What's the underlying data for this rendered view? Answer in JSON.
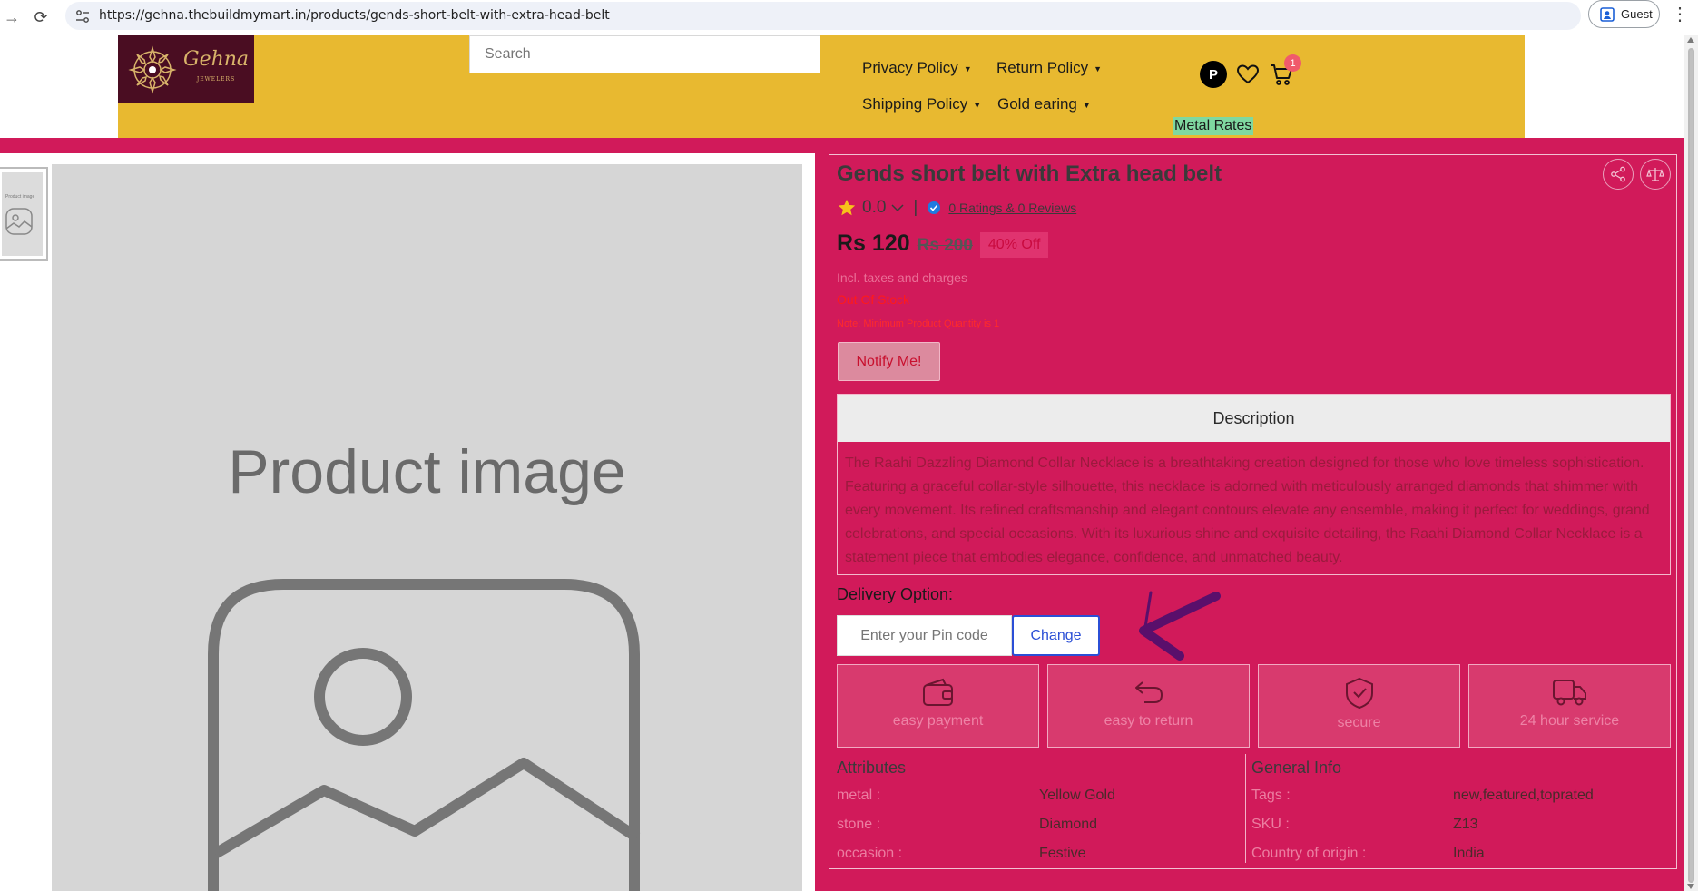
{
  "browser": {
    "url": "https://gehna.thebuildmymart.in/products/gends-short-belt-with-extra-head-belt",
    "profile_label": "Guest"
  },
  "header": {
    "logo": {
      "brand": "Gehna",
      "tagline": "JEWELERS"
    },
    "search_placeholder": "Search",
    "menu": [
      {
        "label": "Privacy Policy"
      },
      {
        "label": "Return Policy"
      },
      {
        "label": "Shipping Policy"
      },
      {
        "label": "Gold earing"
      }
    ],
    "avatar_initial": "P",
    "cart_count": "1",
    "metal_rates_label": "Metal Rates"
  },
  "gallery": {
    "main_image_label": "Product image",
    "thumb_label": "Product image"
  },
  "product": {
    "title": "Gends short belt with Extra head belt",
    "rating": "0.0",
    "ratings_reviews": "0 Ratings  & 0 Reviews",
    "price": "Rs 120",
    "mrp": "Rs 200",
    "discount": "40% Off",
    "tax_note": "Incl. taxes and charges",
    "stock_status": "Out Of Stock",
    "min_qty_note": "Note: Minimum Product Quantity is 1",
    "notify_label": "Notify Me!",
    "description_title": "Description",
    "description": "The Raahi Dazzling Diamond Collar Necklace is a breathtaking creation designed for those who love timeless sophistication. Featuring a graceful collar-style silhouette, this necklace is adorned with meticulously arranged diamonds that shimmer with every movement. Its refined craftsmanship and elegant contours elevate any ensemble, making it perfect for weddings, grand celebrations, and special occasions. With its luxurious shine and exquisite detailing, the Raahi Diamond Collar Necklace is a statement piece that embodies elegance, confidence, and unmatched beauty."
  },
  "delivery": {
    "label": "Delivery Option:",
    "pin_placeholder": "Enter your Pin code",
    "change_label": "Change"
  },
  "features": [
    {
      "label": "easy payment",
      "icon": "wallet-icon"
    },
    {
      "label": "easy to return",
      "icon": "return-arrow-icon"
    },
    {
      "label": "secure",
      "icon": "shield-check-icon"
    },
    {
      "label": "24 hour service",
      "icon": "truck-icon"
    }
  ],
  "attributes": {
    "title": "Attributes",
    "rows": [
      {
        "key": "metal :",
        "value": "Yellow Gold"
      },
      {
        "key": "stone :",
        "value": "Diamond"
      },
      {
        "key": "occasion :",
        "value": "Festive"
      }
    ]
  },
  "general_info": {
    "title": "General Info",
    "rows": [
      {
        "key": "Tags :",
        "value": "new,featured,toprated"
      },
      {
        "key": "SKU :",
        "value": "Z13"
      },
      {
        "key": "Country of origin :",
        "value": "India"
      }
    ]
  },
  "colors": {
    "header_bg": "#e8b930",
    "band_bg": "#d11a5a",
    "logo_bg": "#4a0d22",
    "change_button": "#2b4fd6",
    "annotation_arrow": "#5a0f6b"
  }
}
